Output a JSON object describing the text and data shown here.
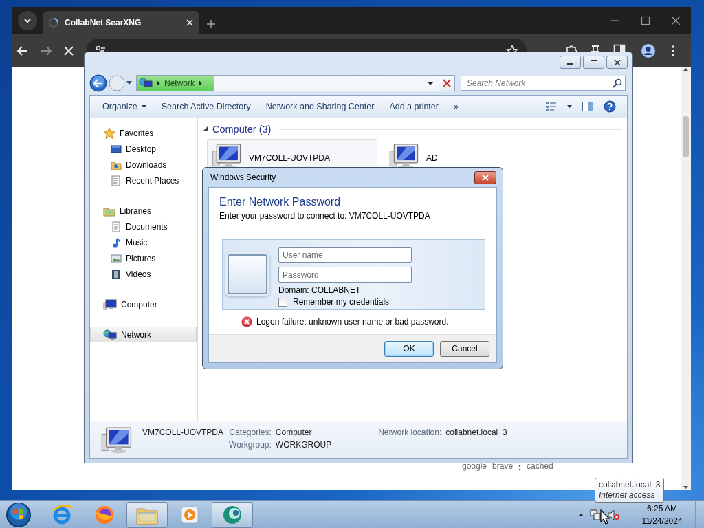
{
  "browser": {
    "tab": {
      "title": "CollabNet SearXNG",
      "loading": true
    },
    "result_links": [
      "google",
      "brave",
      "cached"
    ]
  },
  "explorer": {
    "address": {
      "path": [
        "Network"
      ]
    },
    "search": {
      "placeholder": "Search Network"
    },
    "commands": [
      {
        "label": "Organize",
        "dropdown": true
      },
      {
        "label": "Search Active Directory",
        "dropdown": false
      },
      {
        "label": "Network and Sharing Center",
        "dropdown": false
      },
      {
        "label": "Add a printer",
        "dropdown": false
      }
    ],
    "more": "»",
    "nav": [
      {
        "label": "Favorites",
        "selected": false,
        "children": [
          {
            "label": "Desktop",
            "selected": false
          },
          {
            "label": "Downloads",
            "selected": false
          },
          {
            "label": "Recent Places",
            "selected": false
          }
        ]
      },
      {
        "label": "Libraries",
        "selected": false,
        "children": [
          {
            "label": "Documents",
            "selected": false
          },
          {
            "label": "Music",
            "selected": false
          },
          {
            "label": "Pictures",
            "selected": false
          },
          {
            "label": "Videos",
            "selected": false
          }
        ]
      },
      {
        "label": "Computer",
        "selected": false
      },
      {
        "label": "Network",
        "selected": true
      }
    ],
    "group": {
      "title": "Computer (3)",
      "expanded": true,
      "items": [
        {
          "name": "VM7COLL-UOVTPDA",
          "selected": true
        },
        {
          "name": "AD",
          "selected": false
        }
      ]
    },
    "details": {
      "name": "VM7COLL-UOVTPDA",
      "fields": [
        {
          "label": "Categories:",
          "value": "Computer"
        },
        {
          "label": "Workgroup:",
          "value": "WORKGROUP"
        },
        {
          "label": "Network location:",
          "value": "collabnet.local  3"
        }
      ]
    }
  },
  "dialog": {
    "title": "Windows Security",
    "heading": "Enter Network Password",
    "prompt": "Enter your password to connect to: VM7COLL-UOVTPDA",
    "username": {
      "placeholder": "User name"
    },
    "password": {
      "placeholder": "Password"
    },
    "domain": "Domain: COLLABNET",
    "remember": {
      "label": "Remember my credentials",
      "checked": false
    },
    "error": "Logon failure: unknown user name or bad password.",
    "buttons": [
      {
        "label": "OK",
        "default": true
      },
      {
        "label": "Cancel",
        "default": false
      }
    ]
  },
  "taskbar": {
    "apps": [
      {
        "open": false
      },
      {
        "open": false
      },
      {
        "open": true
      },
      {
        "open": false
      },
      {
        "open": true
      }
    ],
    "clock": {
      "time": "6:25 AM",
      "date": "11/24/2024"
    }
  },
  "tooltip": {
    "title": "collabnet.local  3",
    "subtitle": "Internet access"
  }
}
